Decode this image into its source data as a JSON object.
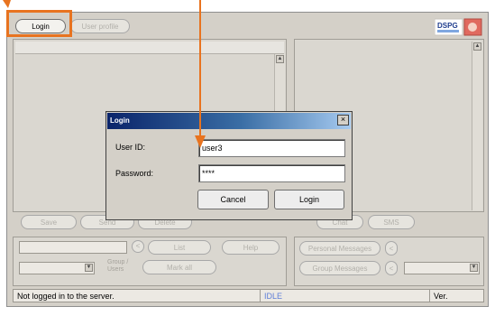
{
  "toolbar": {
    "login_label": "Login",
    "user_profile_label": "User profile",
    "logo_text": "DSPG"
  },
  "buttons_row": {
    "left": [
      "Save",
      "Send",
      "Delete"
    ],
    "right": [
      "Chat",
      "SMS"
    ]
  },
  "lower_left": {
    "btn_list": "List",
    "btn_help": "Help",
    "btn_mark_all": "Mark all",
    "group_label": "Group / Users",
    "stepper": "<"
  },
  "lower_right": {
    "personal_messages": "Personal Messages",
    "group_messages": "Group Messages",
    "stepper": "<"
  },
  "status_bar": {
    "message": "Not logged in to the server.",
    "state": "IDLE",
    "extra": "Ver."
  },
  "dialog": {
    "title": "Login",
    "close_glyph": "×",
    "user_id_label": "User ID:",
    "user_id_value": "user3",
    "password_label": "Password:",
    "password_value": "****",
    "cancel_label": "Cancel",
    "login_label": "Login"
  },
  "colors": {
    "highlight": "#e8731f",
    "title_bar_start": "#0a246a",
    "title_bar_end": "#a6caf0",
    "status_state_text": "#5f7fd8"
  }
}
